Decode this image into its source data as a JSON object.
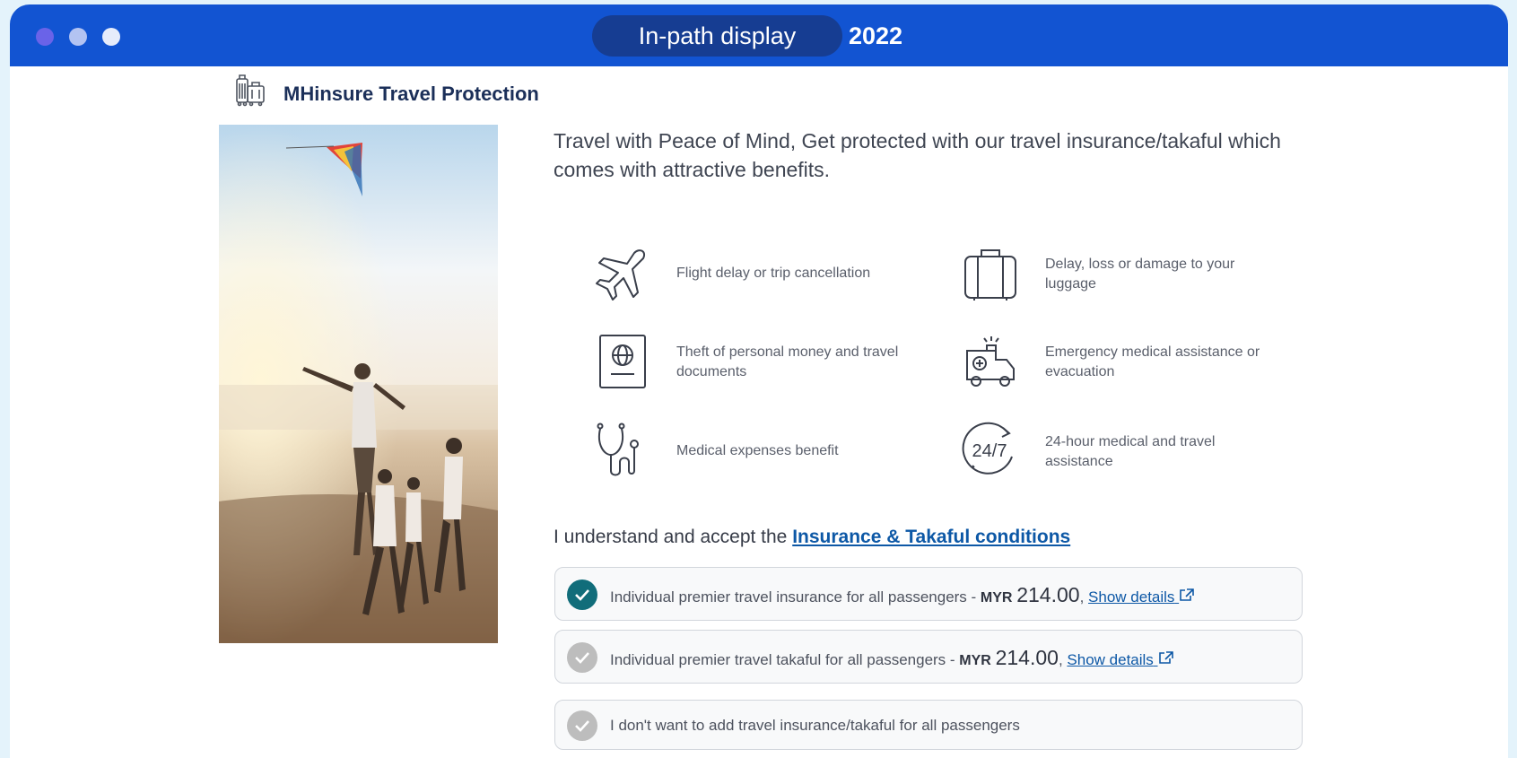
{
  "header": {
    "title": "In-path display",
    "year": "2022"
  },
  "brand": {
    "icon": "luggage-icon",
    "title": "MHinsure Travel Protection"
  },
  "headline": "Travel with Peace of Mind, Get protected with our travel insurance/takaful which comes with attractive benefits.",
  "benefits": [
    {
      "icon": "airplane-icon",
      "text": "Flight delay or trip cancellation"
    },
    {
      "icon": "suitcase-icon",
      "text": "Delay, loss or damage to your luggage"
    },
    {
      "icon": "passport-icon",
      "text": "Theft of personal money and travel documents"
    },
    {
      "icon": "ambulance-icon",
      "text": "Emergency medical assistance or evacuation"
    },
    {
      "icon": "stethoscope-icon",
      "text": "Medical expenses benefit"
    },
    {
      "icon": "clock-24-7-icon",
      "text": "24-hour medical and travel assistance"
    }
  ],
  "clock_label": "24/7",
  "accept": {
    "prefix": "I understand and accept the",
    "link": "Insurance & Takaful conditions"
  },
  "options": [
    {
      "label": "Individual premier travel insurance  for all passengers - ",
      "currency": "MYR",
      "amount": "214.00",
      "separator": ", ",
      "details": "Show details",
      "selected": true
    },
    {
      "label": "Individual premier travel takaful  for all passengers - ",
      "currency": "MYR",
      "amount": "214.00",
      "separator": ", ",
      "details": "Show details",
      "selected": false
    },
    {
      "label": "I don't want to add travel insurance/takaful  for all passengers",
      "selected": false
    }
  ],
  "colors": {
    "titlebar": "#1254d2",
    "pill": "#163d92",
    "selected_radio": "#116d7a",
    "link": "#0d58a6"
  }
}
